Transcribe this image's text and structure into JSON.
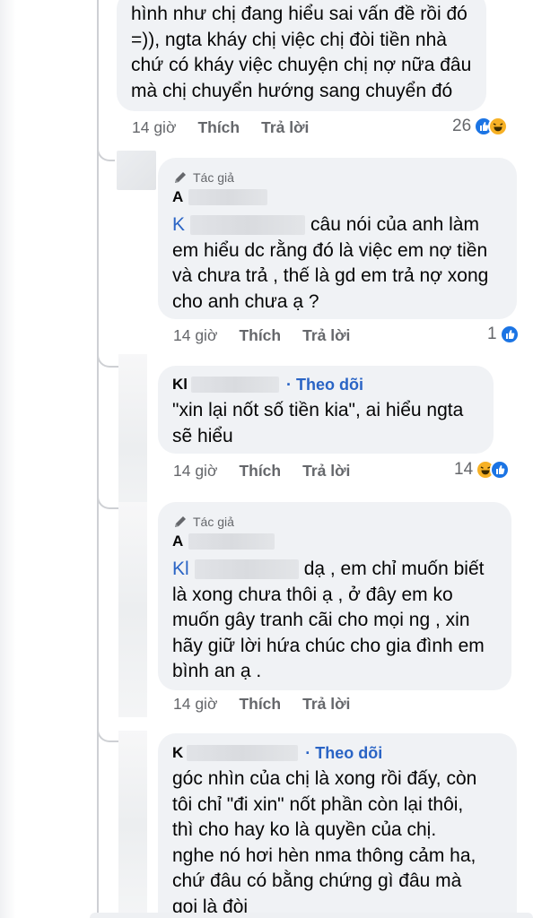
{
  "comment1": {
    "lines": [
      "hình như chị đang hiểu sai vấn đề rồi đó",
      "=)), ngta kháy chị việc chị đòi tiền nhà",
      "chứ có kháy việc chuyện chị nợ nữa đâu",
      "mà chị chuyển hướng sang chuyển đó"
    ],
    "time": "14 giờ",
    "like": "Thích",
    "reply": "Trả lời",
    "reaction_count": "26"
  },
  "comment2": {
    "badge": "Tác giả",
    "author": "A",
    "mention": "K",
    "line1_rest": "câu nói của anh làm",
    "lines": [
      "em hiểu dc rằng đó là việc em nợ tiền",
      "và chưa trả , thế là gd em trả nợ xong",
      "cho anh chưa ạ ?"
    ],
    "time": "14 giờ",
    "like": "Thích",
    "reply": "Trả lời",
    "reaction_count": "1"
  },
  "comment3": {
    "author": "Kl",
    "follow": "· Theo dõi",
    "lines": [
      "\"xin lại nốt số tiền kia\", ai hiểu ngta",
      "sẽ hiểu"
    ],
    "time": "14 giờ",
    "like": "Thích",
    "reply": "Trả lời",
    "reaction_count": "14"
  },
  "comment4": {
    "badge": "Tác giả",
    "author": "A",
    "mention": "Kl",
    "line1_rest": "dạ , em chỉ muốn biết",
    "lines": [
      "là xong chưa thôi ạ , ở đây em ko",
      "muốn gây tranh cãi cho mọi ng , xin",
      "hãy giữ lời hứa chúc cho gia đình em",
      "bình an ạ ."
    ],
    "time": "14 giờ",
    "like": "Thích",
    "reply": "Trả lời"
  },
  "comment5": {
    "author": "K",
    "follow": "· Theo dõi",
    "lines": [
      "góc nhìn của chị là xong rồi đấy, còn",
      "tôi chỉ \"đi xin\" nốt phần còn lại thôi,",
      "thì cho hay ko là quyền của chị.",
      "nghe nó hơi hèn nma thông cảm ha,",
      "chứ đâu có bằng chứng gì đâu mà",
      "gọi là đòi"
    ]
  },
  "colors": {
    "link": "#2a64c5",
    "bubble": "#f0f2f5",
    "meta": "#65676b",
    "like": "#1b74e4",
    "haha": "#f7b125"
  },
  "icons": [
    "pen-icon",
    "like-reaction-icon",
    "haha-reaction-icon"
  ]
}
